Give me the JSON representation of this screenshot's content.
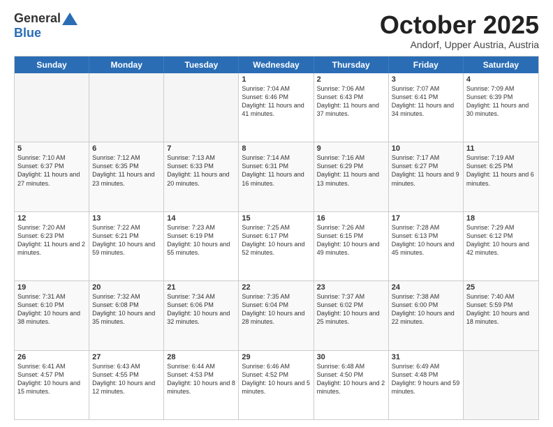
{
  "header": {
    "logo_general": "General",
    "logo_blue": "Blue",
    "month_title": "October 2025",
    "subtitle": "Andorf, Upper Austria, Austria"
  },
  "days_of_week": [
    "Sunday",
    "Monday",
    "Tuesday",
    "Wednesday",
    "Thursday",
    "Friday",
    "Saturday"
  ],
  "weeks": [
    [
      {
        "day": "",
        "text": "",
        "empty": true
      },
      {
        "day": "",
        "text": "",
        "empty": true
      },
      {
        "day": "",
        "text": "",
        "empty": true
      },
      {
        "day": "1",
        "text": "Sunrise: 7:04 AM\nSunset: 6:46 PM\nDaylight: 11 hours and 41 minutes.",
        "empty": false
      },
      {
        "day": "2",
        "text": "Sunrise: 7:06 AM\nSunset: 6:43 PM\nDaylight: 11 hours and 37 minutes.",
        "empty": false
      },
      {
        "day": "3",
        "text": "Sunrise: 7:07 AM\nSunset: 6:41 PM\nDaylight: 11 hours and 34 minutes.",
        "empty": false
      },
      {
        "day": "4",
        "text": "Sunrise: 7:09 AM\nSunset: 6:39 PM\nDaylight: 11 hours and 30 minutes.",
        "empty": false
      }
    ],
    [
      {
        "day": "5",
        "text": "Sunrise: 7:10 AM\nSunset: 6:37 PM\nDaylight: 11 hours and 27 minutes.",
        "empty": false
      },
      {
        "day": "6",
        "text": "Sunrise: 7:12 AM\nSunset: 6:35 PM\nDaylight: 11 hours and 23 minutes.",
        "empty": false
      },
      {
        "day": "7",
        "text": "Sunrise: 7:13 AM\nSunset: 6:33 PM\nDaylight: 11 hours and 20 minutes.",
        "empty": false
      },
      {
        "day": "8",
        "text": "Sunrise: 7:14 AM\nSunset: 6:31 PM\nDaylight: 11 hours and 16 minutes.",
        "empty": false
      },
      {
        "day": "9",
        "text": "Sunrise: 7:16 AM\nSunset: 6:29 PM\nDaylight: 11 hours and 13 minutes.",
        "empty": false
      },
      {
        "day": "10",
        "text": "Sunrise: 7:17 AM\nSunset: 6:27 PM\nDaylight: 11 hours and 9 minutes.",
        "empty": false
      },
      {
        "day": "11",
        "text": "Sunrise: 7:19 AM\nSunset: 6:25 PM\nDaylight: 11 hours and 6 minutes.",
        "empty": false
      }
    ],
    [
      {
        "day": "12",
        "text": "Sunrise: 7:20 AM\nSunset: 6:23 PM\nDaylight: 11 hours and 2 minutes.",
        "empty": false
      },
      {
        "day": "13",
        "text": "Sunrise: 7:22 AM\nSunset: 6:21 PM\nDaylight: 10 hours and 59 minutes.",
        "empty": false
      },
      {
        "day": "14",
        "text": "Sunrise: 7:23 AM\nSunset: 6:19 PM\nDaylight: 10 hours and 55 minutes.",
        "empty": false
      },
      {
        "day": "15",
        "text": "Sunrise: 7:25 AM\nSunset: 6:17 PM\nDaylight: 10 hours and 52 minutes.",
        "empty": false
      },
      {
        "day": "16",
        "text": "Sunrise: 7:26 AM\nSunset: 6:15 PM\nDaylight: 10 hours and 49 minutes.",
        "empty": false
      },
      {
        "day": "17",
        "text": "Sunrise: 7:28 AM\nSunset: 6:13 PM\nDaylight: 10 hours and 45 minutes.",
        "empty": false
      },
      {
        "day": "18",
        "text": "Sunrise: 7:29 AM\nSunset: 6:12 PM\nDaylight: 10 hours and 42 minutes.",
        "empty": false
      }
    ],
    [
      {
        "day": "19",
        "text": "Sunrise: 7:31 AM\nSunset: 6:10 PM\nDaylight: 10 hours and 38 minutes.",
        "empty": false
      },
      {
        "day": "20",
        "text": "Sunrise: 7:32 AM\nSunset: 6:08 PM\nDaylight: 10 hours and 35 minutes.",
        "empty": false
      },
      {
        "day": "21",
        "text": "Sunrise: 7:34 AM\nSunset: 6:06 PM\nDaylight: 10 hours and 32 minutes.",
        "empty": false
      },
      {
        "day": "22",
        "text": "Sunrise: 7:35 AM\nSunset: 6:04 PM\nDaylight: 10 hours and 28 minutes.",
        "empty": false
      },
      {
        "day": "23",
        "text": "Sunrise: 7:37 AM\nSunset: 6:02 PM\nDaylight: 10 hours and 25 minutes.",
        "empty": false
      },
      {
        "day": "24",
        "text": "Sunrise: 7:38 AM\nSunset: 6:00 PM\nDaylight: 10 hours and 22 minutes.",
        "empty": false
      },
      {
        "day": "25",
        "text": "Sunrise: 7:40 AM\nSunset: 5:59 PM\nDaylight: 10 hours and 18 minutes.",
        "empty": false
      }
    ],
    [
      {
        "day": "26",
        "text": "Sunrise: 6:41 AM\nSunset: 4:57 PM\nDaylight: 10 hours and 15 minutes.",
        "empty": false
      },
      {
        "day": "27",
        "text": "Sunrise: 6:43 AM\nSunset: 4:55 PM\nDaylight: 10 hours and 12 minutes.",
        "empty": false
      },
      {
        "day": "28",
        "text": "Sunrise: 6:44 AM\nSunset: 4:53 PM\nDaylight: 10 hours and 8 minutes.",
        "empty": false
      },
      {
        "day": "29",
        "text": "Sunrise: 6:46 AM\nSunset: 4:52 PM\nDaylight: 10 hours and 5 minutes.",
        "empty": false
      },
      {
        "day": "30",
        "text": "Sunrise: 6:48 AM\nSunset: 4:50 PM\nDaylight: 10 hours and 2 minutes.",
        "empty": false
      },
      {
        "day": "31",
        "text": "Sunrise: 6:49 AM\nSunset: 4:48 PM\nDaylight: 9 hours and 59 minutes.",
        "empty": false
      },
      {
        "day": "",
        "text": "",
        "empty": true
      }
    ]
  ]
}
